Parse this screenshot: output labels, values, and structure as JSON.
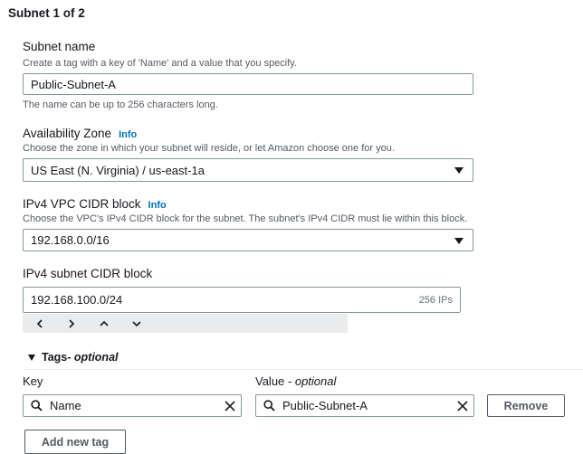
{
  "section": {
    "title": "Subnet 1 of 2"
  },
  "subnet_name": {
    "label": "Subnet name",
    "description": "Create a tag with a key of 'Name' and a value that you specify.",
    "value": "Public-Subnet-A",
    "constraint": "The name can be up to 256 characters long."
  },
  "availability_zone": {
    "label": "Availability Zone",
    "info": "Info",
    "description": "Choose the zone in which your subnet will reside, or let Amazon choose one for you.",
    "selected": "US East (N. Virginia) / us-east-1a"
  },
  "vpc_cidr": {
    "label": "IPv4 VPC CIDR block",
    "info": "Info",
    "description": "Choose the VPC's IPv4 CIDR block for the subnet. The subnet's IPv4 CIDR must lie within this block.",
    "selected": "192.168.0.0/16"
  },
  "subnet_cidr": {
    "label": "IPv4 subnet CIDR block",
    "value": "192.168.100.0/24",
    "ip_count": "256 IPs",
    "stepper": {
      "left": "‹",
      "right": "›",
      "up": "⌃",
      "down": "⌄"
    }
  },
  "tags": {
    "toggle_label": "Tags",
    "toggle_suffix": " - optional",
    "key_header": "Key",
    "value_header": "Value",
    "value_header_suffix": " - optional",
    "rows": [
      {
        "key": "Name",
        "value": "Public-Subnet-A",
        "remove_label": "Remove"
      }
    ],
    "add_label": "Add new tag"
  },
  "colors": {
    "link": "#0073bb",
    "border": "#879596",
    "text": "#16191f",
    "muted": "#545b64"
  }
}
